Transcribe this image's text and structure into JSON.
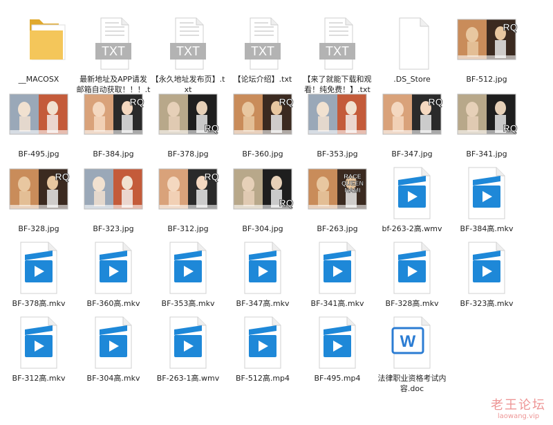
{
  "files": [
    {
      "name": "__MACOSX",
      "icon": "folder-icon"
    },
    {
      "name": "最新地址及APP请发邮箱自动获取！！！.txt",
      "icon": "txt-file-icon",
      "badge": "TXT"
    },
    {
      "name": "【永久地址发布页】.txt",
      "icon": "txt-file-icon",
      "badge": "TXT"
    },
    {
      "name": "【论坛介绍】.txt",
      "icon": "txt-file-icon",
      "badge": "TXT"
    },
    {
      "name": "【来了就能下载和观看！纯免费！】.txt",
      "icon": "txt-file-icon",
      "badge": "TXT"
    },
    {
      "name": ".DS_Store",
      "icon": "blank-file-icon"
    },
    {
      "name": "BF-512.jpg",
      "icon": "image-thumbnail",
      "overlay": "RQ"
    },
    {
      "name": "BF-495.jpg",
      "icon": "image-thumbnail",
      "overlay": ""
    },
    {
      "name": "BF-384.jpg",
      "icon": "image-thumbnail",
      "overlay": "RQ"
    },
    {
      "name": "BF-378.jpg",
      "icon": "image-thumbnail",
      "overlay": "RQ"
    },
    {
      "name": "BF-360.jpg",
      "icon": "image-thumbnail",
      "overlay": "RQ"
    },
    {
      "name": "BF-353.jpg",
      "icon": "image-thumbnail",
      "overlay": ""
    },
    {
      "name": "BF-347.jpg",
      "icon": "image-thumbnail",
      "overlay": "RQ"
    },
    {
      "name": "BF-341.jpg",
      "icon": "image-thumbnail",
      "overlay": "RQ"
    },
    {
      "name": "BF-328.jpg",
      "icon": "image-thumbnail",
      "overlay": "RQ"
    },
    {
      "name": "BF-323.jpg",
      "icon": "image-thumbnail",
      "overlay": ""
    },
    {
      "name": "BF-312.jpg",
      "icon": "image-thumbnail",
      "overlay": "RQ"
    },
    {
      "name": "BF-304.jpg",
      "icon": "image-thumbnail",
      "overlay": "RQ"
    },
    {
      "name": "BF-263.jpg",
      "icon": "image-thumbnail",
      "overlay": "RACE QUEEN NAMI"
    },
    {
      "name": "bf-263-2高.wmv",
      "icon": "video-file-icon"
    },
    {
      "name": "BF-384高.mkv",
      "icon": "video-file-icon"
    },
    {
      "name": "BF-378高.mkv",
      "icon": "video-file-icon"
    },
    {
      "name": "BF-360高.mkv",
      "icon": "video-file-icon"
    },
    {
      "name": "BF-353高.mkv",
      "icon": "video-file-icon"
    },
    {
      "name": "BF-347高.mkv",
      "icon": "video-file-icon"
    },
    {
      "name": "BF-341高.mkv",
      "icon": "video-file-icon"
    },
    {
      "name": "BF-328高.mkv",
      "icon": "video-file-icon"
    },
    {
      "name": "BF-323高.mkv",
      "icon": "video-file-icon"
    },
    {
      "name": "BF-312高.mkv",
      "icon": "video-file-icon"
    },
    {
      "name": "BF-304高.mkv",
      "icon": "video-file-icon"
    },
    {
      "name": "BF-263-1高.wmv",
      "icon": "video-file-icon"
    },
    {
      "name": "BF-512高.mp4",
      "icon": "video-file-icon"
    },
    {
      "name": "BF-495.mp4",
      "icon": "video-file-icon"
    },
    {
      "name": "法律职业资格考试内容.doc",
      "icon": "word-doc-icon",
      "badge": "W"
    }
  ],
  "watermark": {
    "text": "老王论坛",
    "url": "laowang.vip"
  },
  "colors": {
    "folder": "#f4c65a",
    "folder_dark": "#e0a92e",
    "video_blue": "#1e88d8",
    "word_blue": "#2b7cd3",
    "watermark": "#e04040"
  }
}
